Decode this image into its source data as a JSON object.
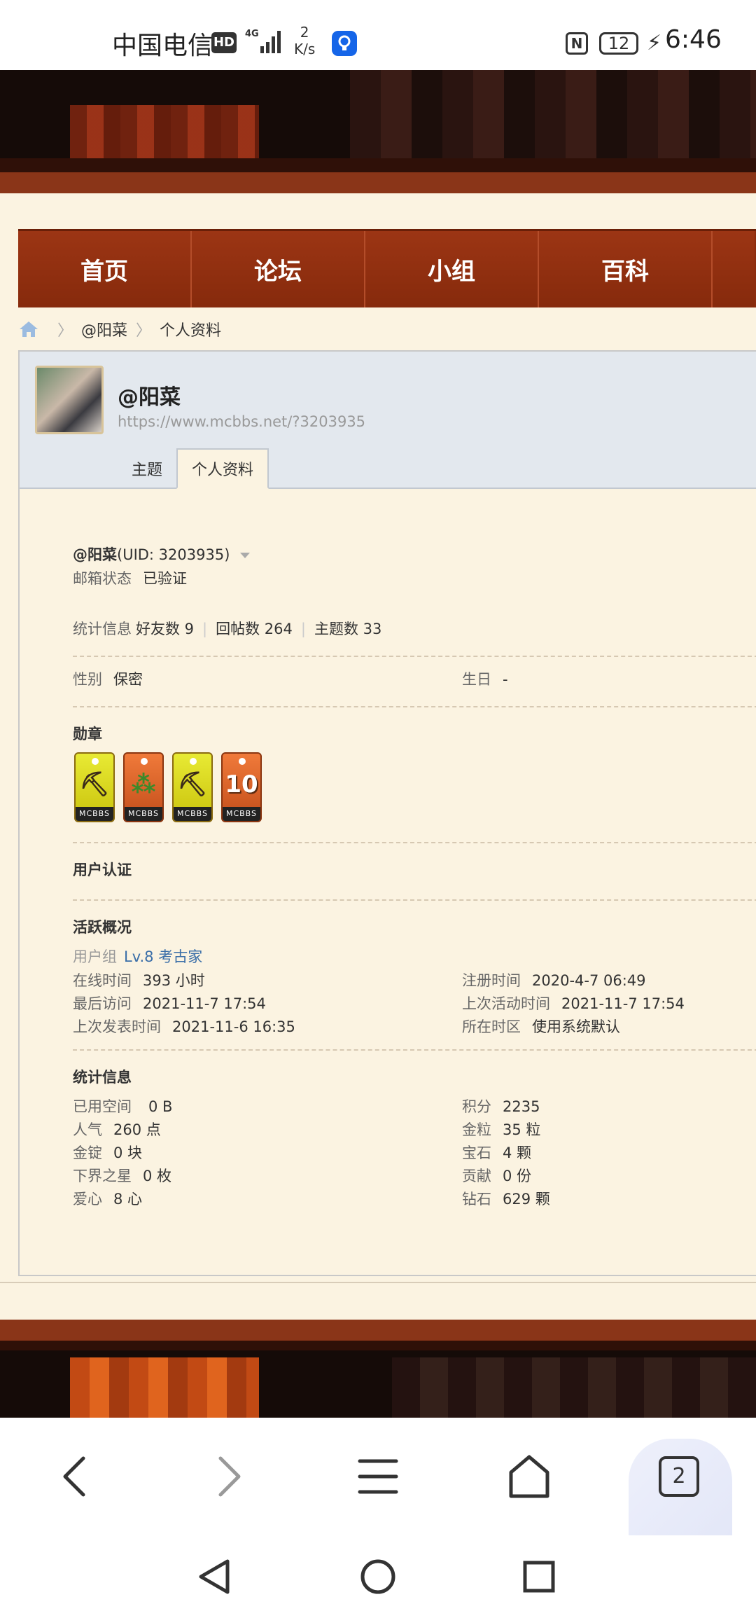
{
  "status_bar": {
    "carrier": "中国电信",
    "hd": "HD",
    "network_speed_value": "2",
    "network_speed_unit": "K/s",
    "battery": "12",
    "time": "6:46"
  },
  "nav": {
    "items": [
      "首页",
      "论坛",
      "小组",
      "百科"
    ]
  },
  "breadcrumb": {
    "items": [
      "@阳菜",
      "个人资料"
    ]
  },
  "profile": {
    "name": "@阳菜",
    "url": "https://www.mcbbs.net/?3203935",
    "tabs": [
      "主题",
      "个人资料"
    ],
    "active_tab": "个人资料"
  },
  "details": {
    "username": "@阳菜",
    "uid": "(UID: 3203935)",
    "email_label": "邮箱状态",
    "email_value": "已验证",
    "stats_label": "统计信息",
    "friends": "好友数 9",
    "replies": "回帖数 264",
    "topics": "主题数 33",
    "gender_label": "性别",
    "gender_value": "保密",
    "birthday_label": "生日",
    "birthday_value": "-",
    "medals_title": "勋章",
    "medal_tag": "MCBBS",
    "medal_10": "10",
    "verification_title": "用户认证",
    "activity_title": "活跃概况",
    "usergroup_label": "用户组",
    "usergroup_value": "Lv.8 考古家",
    "online_label": "在线时间",
    "online_value": "393 小时",
    "register_label": "注册时间",
    "register_value": "2020-4-7 06:49",
    "last_visit_label": "最后访问",
    "last_visit_value": "2021-11-7 17:54",
    "last_active_label": "上次活动时间",
    "last_active_value": "2021-11-7 17:54",
    "last_post_label": "上次发表时间",
    "last_post_value": "2021-11-6 16:35",
    "timezone_label": "所在时区",
    "timezone_value": "使用系统默认",
    "statistics_title": "统计信息",
    "space_label": "已用空间",
    "space_value": "0 B",
    "points_label": "积分",
    "points_value": "2235",
    "popularity_label": "人气",
    "popularity_value": "260 点",
    "gold_grain_label": "金粒",
    "gold_grain_value": "35 粒",
    "ingot_label": "金锭",
    "ingot_value": "0 块",
    "gem_label": "宝石",
    "gem_value": "4 颗",
    "nether_star_label": "下界之星",
    "nether_star_value": "0 枚",
    "contribution_label": "贡献",
    "contribution_value": "0 份",
    "heart_label": "爱心",
    "heart_value": "8 心",
    "diamond_label": "钻石",
    "diamond_value": "629 颗"
  },
  "toolbar": {
    "tab_count": "2"
  }
}
